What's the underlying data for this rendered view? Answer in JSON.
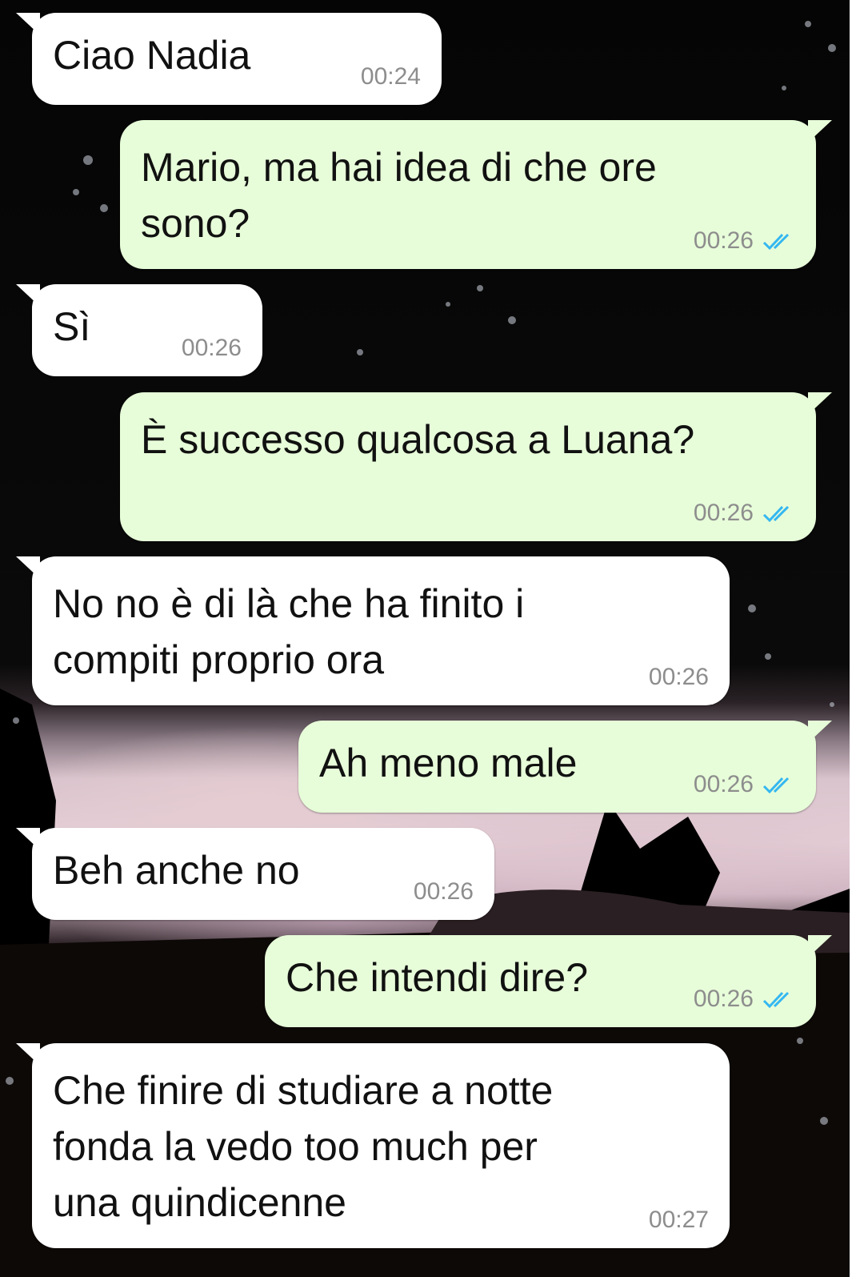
{
  "chat": {
    "messages": [
      {
        "direction": "incoming",
        "text": "Ciao Nadia",
        "time": "00:24"
      },
      {
        "direction": "outgoing",
        "text": "Mario, ma hai idea di che ore\nsono?",
        "time": "00:26",
        "status": "read"
      },
      {
        "direction": "incoming",
        "text": "Sì",
        "time": "00:26"
      },
      {
        "direction": "outgoing",
        "text": "È successo qualcosa a Luana?",
        "time": "00:26",
        "status": "read"
      },
      {
        "direction": "incoming",
        "text": "No no è di là che ha finito i\ncompiti proprio ora",
        "time": "00:26"
      },
      {
        "direction": "outgoing",
        "text": "Ah meno male",
        "time": "00:26",
        "status": "read"
      },
      {
        "direction": "incoming",
        "text": "Beh anche no",
        "time": "00:26"
      },
      {
        "direction": "outgoing",
        "text": "Che intendi dire?",
        "time": "00:26",
        "status": "read"
      },
      {
        "direction": "incoming",
        "text": "Che finire di studiare a notte\nfonda la vedo too much per\nuna quindicenne",
        "time": "00:27"
      }
    ]
  },
  "colors": {
    "incoming_bubble": "#ffffff",
    "outgoing_bubble": "#e7fdd9",
    "read_ticks": "#34b7f1",
    "timestamp": "#8d8d8d"
  },
  "icons": {
    "read_status": "double-check-icon"
  }
}
